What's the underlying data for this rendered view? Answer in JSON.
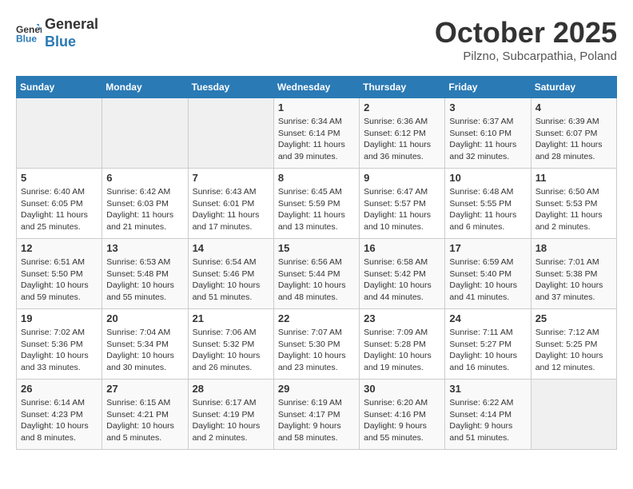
{
  "header": {
    "logo_line1": "General",
    "logo_line2": "Blue",
    "month": "October 2025",
    "location": "Pilzno, Subcarpathia, Poland"
  },
  "days_of_week": [
    "Sunday",
    "Monday",
    "Tuesday",
    "Wednesday",
    "Thursday",
    "Friday",
    "Saturday"
  ],
  "weeks": [
    [
      {
        "day": "",
        "info": ""
      },
      {
        "day": "",
        "info": ""
      },
      {
        "day": "",
        "info": ""
      },
      {
        "day": "1",
        "info": "Sunrise: 6:34 AM\nSunset: 6:14 PM\nDaylight: 11 hours and 39 minutes."
      },
      {
        "day": "2",
        "info": "Sunrise: 6:36 AM\nSunset: 6:12 PM\nDaylight: 11 hours and 36 minutes."
      },
      {
        "day": "3",
        "info": "Sunrise: 6:37 AM\nSunset: 6:10 PM\nDaylight: 11 hours and 32 minutes."
      },
      {
        "day": "4",
        "info": "Sunrise: 6:39 AM\nSunset: 6:07 PM\nDaylight: 11 hours and 28 minutes."
      }
    ],
    [
      {
        "day": "5",
        "info": "Sunrise: 6:40 AM\nSunset: 6:05 PM\nDaylight: 11 hours and 25 minutes."
      },
      {
        "day": "6",
        "info": "Sunrise: 6:42 AM\nSunset: 6:03 PM\nDaylight: 11 hours and 21 minutes."
      },
      {
        "day": "7",
        "info": "Sunrise: 6:43 AM\nSunset: 6:01 PM\nDaylight: 11 hours and 17 minutes."
      },
      {
        "day": "8",
        "info": "Sunrise: 6:45 AM\nSunset: 5:59 PM\nDaylight: 11 hours and 13 minutes."
      },
      {
        "day": "9",
        "info": "Sunrise: 6:47 AM\nSunset: 5:57 PM\nDaylight: 11 hours and 10 minutes."
      },
      {
        "day": "10",
        "info": "Sunrise: 6:48 AM\nSunset: 5:55 PM\nDaylight: 11 hours and 6 minutes."
      },
      {
        "day": "11",
        "info": "Sunrise: 6:50 AM\nSunset: 5:53 PM\nDaylight: 11 hours and 2 minutes."
      }
    ],
    [
      {
        "day": "12",
        "info": "Sunrise: 6:51 AM\nSunset: 5:50 PM\nDaylight: 10 hours and 59 minutes."
      },
      {
        "day": "13",
        "info": "Sunrise: 6:53 AM\nSunset: 5:48 PM\nDaylight: 10 hours and 55 minutes."
      },
      {
        "day": "14",
        "info": "Sunrise: 6:54 AM\nSunset: 5:46 PM\nDaylight: 10 hours and 51 minutes."
      },
      {
        "day": "15",
        "info": "Sunrise: 6:56 AM\nSunset: 5:44 PM\nDaylight: 10 hours and 48 minutes."
      },
      {
        "day": "16",
        "info": "Sunrise: 6:58 AM\nSunset: 5:42 PM\nDaylight: 10 hours and 44 minutes."
      },
      {
        "day": "17",
        "info": "Sunrise: 6:59 AM\nSunset: 5:40 PM\nDaylight: 10 hours and 41 minutes."
      },
      {
        "day": "18",
        "info": "Sunrise: 7:01 AM\nSunset: 5:38 PM\nDaylight: 10 hours and 37 minutes."
      }
    ],
    [
      {
        "day": "19",
        "info": "Sunrise: 7:02 AM\nSunset: 5:36 PM\nDaylight: 10 hours and 33 minutes."
      },
      {
        "day": "20",
        "info": "Sunrise: 7:04 AM\nSunset: 5:34 PM\nDaylight: 10 hours and 30 minutes."
      },
      {
        "day": "21",
        "info": "Sunrise: 7:06 AM\nSunset: 5:32 PM\nDaylight: 10 hours and 26 minutes."
      },
      {
        "day": "22",
        "info": "Sunrise: 7:07 AM\nSunset: 5:30 PM\nDaylight: 10 hours and 23 minutes."
      },
      {
        "day": "23",
        "info": "Sunrise: 7:09 AM\nSunset: 5:28 PM\nDaylight: 10 hours and 19 minutes."
      },
      {
        "day": "24",
        "info": "Sunrise: 7:11 AM\nSunset: 5:27 PM\nDaylight: 10 hours and 16 minutes."
      },
      {
        "day": "25",
        "info": "Sunrise: 7:12 AM\nSunset: 5:25 PM\nDaylight: 10 hours and 12 minutes."
      }
    ],
    [
      {
        "day": "26",
        "info": "Sunrise: 6:14 AM\nSunset: 4:23 PM\nDaylight: 10 hours and 8 minutes."
      },
      {
        "day": "27",
        "info": "Sunrise: 6:15 AM\nSunset: 4:21 PM\nDaylight: 10 hours and 5 minutes."
      },
      {
        "day": "28",
        "info": "Sunrise: 6:17 AM\nSunset: 4:19 PM\nDaylight: 10 hours and 2 minutes."
      },
      {
        "day": "29",
        "info": "Sunrise: 6:19 AM\nSunset: 4:17 PM\nDaylight: 9 hours and 58 minutes."
      },
      {
        "day": "30",
        "info": "Sunrise: 6:20 AM\nSunset: 4:16 PM\nDaylight: 9 hours and 55 minutes."
      },
      {
        "day": "31",
        "info": "Sunrise: 6:22 AM\nSunset: 4:14 PM\nDaylight: 9 hours and 51 minutes."
      },
      {
        "day": "",
        "info": ""
      }
    ]
  ]
}
